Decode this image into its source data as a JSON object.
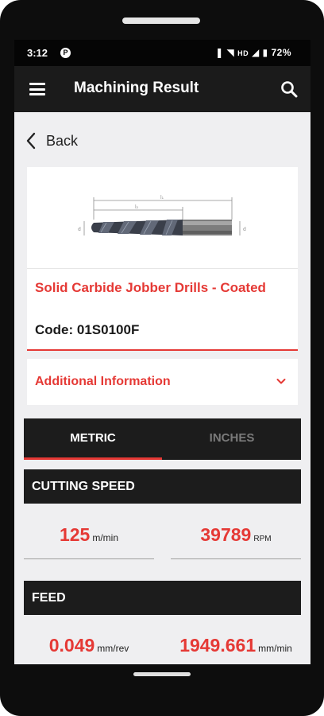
{
  "status_bar": {
    "time": "3:12",
    "p_icon": "P",
    "hd": "HD",
    "battery": "72%"
  },
  "app_bar": {
    "title": "Machining Result",
    "menu_icon": "hamburger-menu-icon",
    "search_icon": "search-icon"
  },
  "back": {
    "label": "Back"
  },
  "product": {
    "image": "drill-bit-illustration",
    "title": "Solid Carbide Jobber Drills - Coated",
    "code": "Code: 01S0100F"
  },
  "additional_info": {
    "label": "Additional Information"
  },
  "unit_tabs": {
    "metric": "METRIC",
    "inches": "INCHES",
    "selected": "METRIC"
  },
  "cutting_speed": {
    "title": "CUTTING SPEED",
    "speed_value": "125",
    "speed_unit": "m/min",
    "rpm_value": "39789",
    "rpm_unit": "RPM"
  },
  "feed": {
    "title": "FEED",
    "per_rev_value": "0.049",
    "per_rev_unit": "mm/rev",
    "per_min_value": "1949.661",
    "per_min_unit": "mm/min"
  },
  "colors": {
    "accent": "#e53935",
    "dark": "#1c1c1c",
    "background": "#efeff1"
  }
}
